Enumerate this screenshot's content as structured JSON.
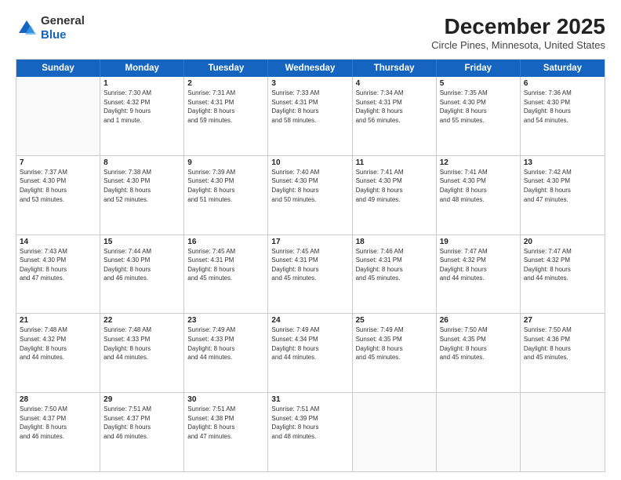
{
  "logo": {
    "general": "General",
    "blue": "Blue"
  },
  "title": "December 2025",
  "subtitle": "Circle Pines, Minnesota, United States",
  "days_of_week": [
    "Sunday",
    "Monday",
    "Tuesday",
    "Wednesday",
    "Thursday",
    "Friday",
    "Saturday"
  ],
  "weeks": [
    [
      {
        "day": "",
        "info": ""
      },
      {
        "day": "1",
        "info": "Sunrise: 7:30 AM\nSunset: 4:32 PM\nDaylight: 9 hours\nand 1 minute."
      },
      {
        "day": "2",
        "info": "Sunrise: 7:31 AM\nSunset: 4:31 PM\nDaylight: 8 hours\nand 59 minutes."
      },
      {
        "day": "3",
        "info": "Sunrise: 7:33 AM\nSunset: 4:31 PM\nDaylight: 8 hours\nand 58 minutes."
      },
      {
        "day": "4",
        "info": "Sunrise: 7:34 AM\nSunset: 4:31 PM\nDaylight: 8 hours\nand 56 minutes."
      },
      {
        "day": "5",
        "info": "Sunrise: 7:35 AM\nSunset: 4:30 PM\nDaylight: 8 hours\nand 55 minutes."
      },
      {
        "day": "6",
        "info": "Sunrise: 7:36 AM\nSunset: 4:30 PM\nDaylight: 8 hours\nand 54 minutes."
      }
    ],
    [
      {
        "day": "7",
        "info": "Sunrise: 7:37 AM\nSunset: 4:30 PM\nDaylight: 8 hours\nand 53 minutes."
      },
      {
        "day": "8",
        "info": "Sunrise: 7:38 AM\nSunset: 4:30 PM\nDaylight: 8 hours\nand 52 minutes."
      },
      {
        "day": "9",
        "info": "Sunrise: 7:39 AM\nSunset: 4:30 PM\nDaylight: 8 hours\nand 51 minutes."
      },
      {
        "day": "10",
        "info": "Sunrise: 7:40 AM\nSunset: 4:30 PM\nDaylight: 8 hours\nand 50 minutes."
      },
      {
        "day": "11",
        "info": "Sunrise: 7:41 AM\nSunset: 4:30 PM\nDaylight: 8 hours\nand 49 minutes."
      },
      {
        "day": "12",
        "info": "Sunrise: 7:41 AM\nSunset: 4:30 PM\nDaylight: 8 hours\nand 48 minutes."
      },
      {
        "day": "13",
        "info": "Sunrise: 7:42 AM\nSunset: 4:30 PM\nDaylight: 8 hours\nand 47 minutes."
      }
    ],
    [
      {
        "day": "14",
        "info": "Sunrise: 7:43 AM\nSunset: 4:30 PM\nDaylight: 8 hours\nand 47 minutes."
      },
      {
        "day": "15",
        "info": "Sunrise: 7:44 AM\nSunset: 4:30 PM\nDaylight: 8 hours\nand 46 minutes."
      },
      {
        "day": "16",
        "info": "Sunrise: 7:45 AM\nSunset: 4:31 PM\nDaylight: 8 hours\nand 45 minutes."
      },
      {
        "day": "17",
        "info": "Sunrise: 7:45 AM\nSunset: 4:31 PM\nDaylight: 8 hours\nand 45 minutes."
      },
      {
        "day": "18",
        "info": "Sunrise: 7:46 AM\nSunset: 4:31 PM\nDaylight: 8 hours\nand 45 minutes."
      },
      {
        "day": "19",
        "info": "Sunrise: 7:47 AM\nSunset: 4:32 PM\nDaylight: 8 hours\nand 44 minutes."
      },
      {
        "day": "20",
        "info": "Sunrise: 7:47 AM\nSunset: 4:32 PM\nDaylight: 8 hours\nand 44 minutes."
      }
    ],
    [
      {
        "day": "21",
        "info": "Sunrise: 7:48 AM\nSunset: 4:32 PM\nDaylight: 8 hours\nand 44 minutes."
      },
      {
        "day": "22",
        "info": "Sunrise: 7:48 AM\nSunset: 4:33 PM\nDaylight: 8 hours\nand 44 minutes."
      },
      {
        "day": "23",
        "info": "Sunrise: 7:49 AM\nSunset: 4:33 PM\nDaylight: 8 hours\nand 44 minutes."
      },
      {
        "day": "24",
        "info": "Sunrise: 7:49 AM\nSunset: 4:34 PM\nDaylight: 8 hours\nand 44 minutes."
      },
      {
        "day": "25",
        "info": "Sunrise: 7:49 AM\nSunset: 4:35 PM\nDaylight: 8 hours\nand 45 minutes."
      },
      {
        "day": "26",
        "info": "Sunrise: 7:50 AM\nSunset: 4:35 PM\nDaylight: 8 hours\nand 45 minutes."
      },
      {
        "day": "27",
        "info": "Sunrise: 7:50 AM\nSunset: 4:36 PM\nDaylight: 8 hours\nand 45 minutes."
      }
    ],
    [
      {
        "day": "28",
        "info": "Sunrise: 7:50 AM\nSunset: 4:37 PM\nDaylight: 8 hours\nand 46 minutes."
      },
      {
        "day": "29",
        "info": "Sunrise: 7:51 AM\nSunset: 4:37 PM\nDaylight: 8 hours\nand 46 minutes."
      },
      {
        "day": "30",
        "info": "Sunrise: 7:51 AM\nSunset: 4:38 PM\nDaylight: 8 hours\nand 47 minutes."
      },
      {
        "day": "31",
        "info": "Sunrise: 7:51 AM\nSunset: 4:39 PM\nDaylight: 8 hours\nand 48 minutes."
      },
      {
        "day": "",
        "info": ""
      },
      {
        "day": "",
        "info": ""
      },
      {
        "day": "",
        "info": ""
      }
    ]
  ]
}
